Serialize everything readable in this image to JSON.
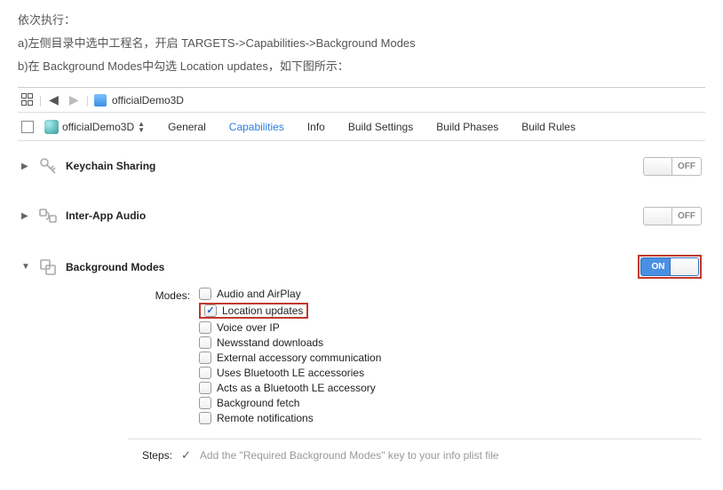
{
  "instructions": {
    "line1": "依次执行：",
    "line2": "a)左侧目录中选中工程名，开启 TARGETS->Capabilities->Background Modes",
    "line3": "b)在 Background Modes中勾选 Location updates，如下图所示："
  },
  "breadcrumb": {
    "project": "officialDemo3D"
  },
  "target": {
    "name": "officialDemo3D"
  },
  "tabs": {
    "general": "General",
    "capabilities": "Capabilities",
    "info": "Info",
    "build_settings": "Build Settings",
    "build_phases": "Build Phases",
    "build_rules": "Build Rules"
  },
  "capabilities": {
    "keychain": {
      "title": "Keychain Sharing",
      "state": "OFF"
    },
    "interapp": {
      "title": "Inter-App Audio",
      "state": "OFF"
    },
    "background": {
      "title": "Background Modes",
      "state": "ON"
    }
  },
  "modes_label": "Modes:",
  "modes": [
    {
      "label": "Audio and AirPlay",
      "checked": false
    },
    {
      "label": "Location updates",
      "checked": true,
      "highlighted": true
    },
    {
      "label": "Voice over IP",
      "checked": false
    },
    {
      "label": "Newsstand downloads",
      "checked": false
    },
    {
      "label": "External accessory communication",
      "checked": false
    },
    {
      "label": "Uses Bluetooth LE accessories",
      "checked": false
    },
    {
      "label": "Acts as a Bluetooth LE accessory",
      "checked": false
    },
    {
      "label": "Background fetch",
      "checked": false
    },
    {
      "label": "Remote notifications",
      "checked": false
    }
  ],
  "steps": {
    "label": "Steps:",
    "text": "Add the \"Required Background Modes\" key to your info plist file"
  }
}
